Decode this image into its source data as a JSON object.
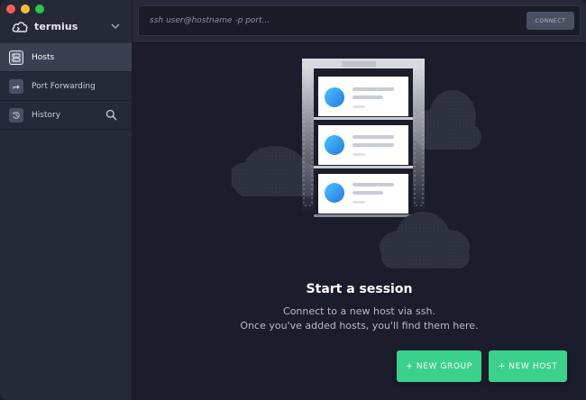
{
  "app": {
    "name": "termius"
  },
  "sidebar": {
    "items": [
      {
        "label": "Hosts",
        "icon": "server-icon",
        "active": true
      },
      {
        "label": "Port Forwarding",
        "icon": "arrow-forward-icon",
        "active": false
      },
      {
        "label": "History",
        "icon": "history-icon",
        "active": false
      }
    ]
  },
  "toolbar": {
    "address_placeholder": "ssh user@hostname -p port...",
    "connect_label": "CONNECT"
  },
  "empty_state": {
    "title": "Start a session",
    "line1": "Connect to a new host via ssh.",
    "line2": "Once you've added hosts, you'll find them here."
  },
  "actions": {
    "new_group": "+ NEW GROUP",
    "new_host": "+ NEW HOST"
  },
  "colors": {
    "accent": "#3ad28a",
    "sidebar_bg": "#262a38",
    "main_bg": "#1b1d2c",
    "active_item": "#3a3f52"
  }
}
